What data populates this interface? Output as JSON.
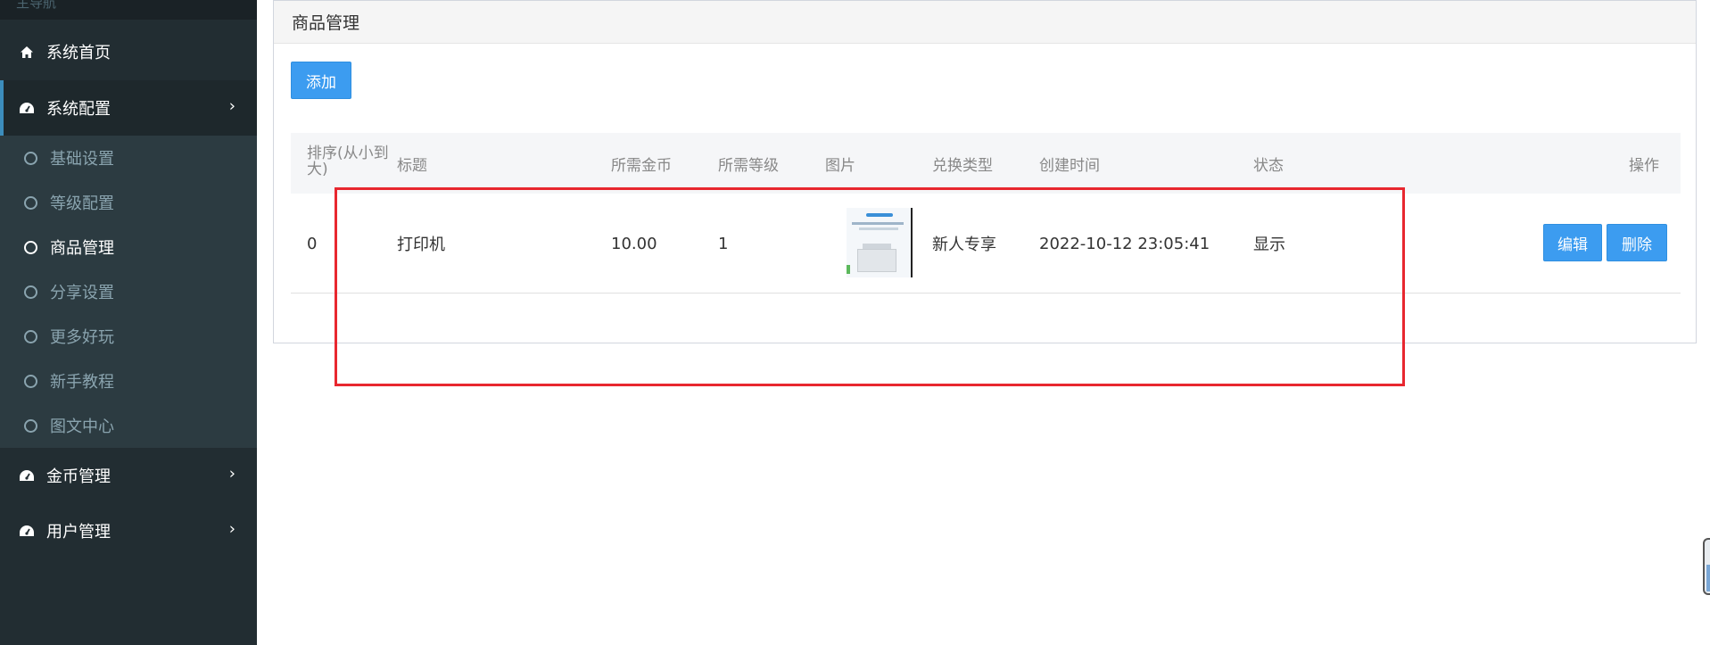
{
  "sidebar": {
    "header": "主导航",
    "items": [
      {
        "label": "系统首页",
        "icon": "home-icon"
      },
      {
        "label": "系统配置",
        "icon": "dashboard-icon"
      },
      {
        "label": "金币管理",
        "icon": "dashboard-icon"
      },
      {
        "label": "用户管理",
        "icon": "dashboard-icon"
      }
    ],
    "submenu": [
      {
        "label": "基础设置"
      },
      {
        "label": "等级配置"
      },
      {
        "label": "商品管理"
      },
      {
        "label": "分享设置"
      },
      {
        "label": "更多好玩"
      },
      {
        "label": "新手教程"
      },
      {
        "label": "图文中心"
      }
    ]
  },
  "main": {
    "title": "商品管理",
    "add_label": "添加",
    "table": {
      "headers": [
        "排序(从小到大)",
        "标题",
        "所需金币",
        "所需等级",
        "图片",
        "兑换类型",
        "创建时间",
        "状态",
        "操作"
      ],
      "rows": [
        {
          "order": "0",
          "title": "打印机",
          "coins": "10.00",
          "level": "1",
          "image": "printer-product-image",
          "type": "新人专享",
          "created": "2022-10-12 23:05:41",
          "status": "显示",
          "edit_label": "编辑",
          "delete_label": "删除"
        }
      ]
    }
  },
  "colors": {
    "sidebar_bg": "#222d32",
    "submenu_bg": "#2c3b41",
    "accent": "#3c9cf0",
    "highlight": "#e8272f"
  }
}
